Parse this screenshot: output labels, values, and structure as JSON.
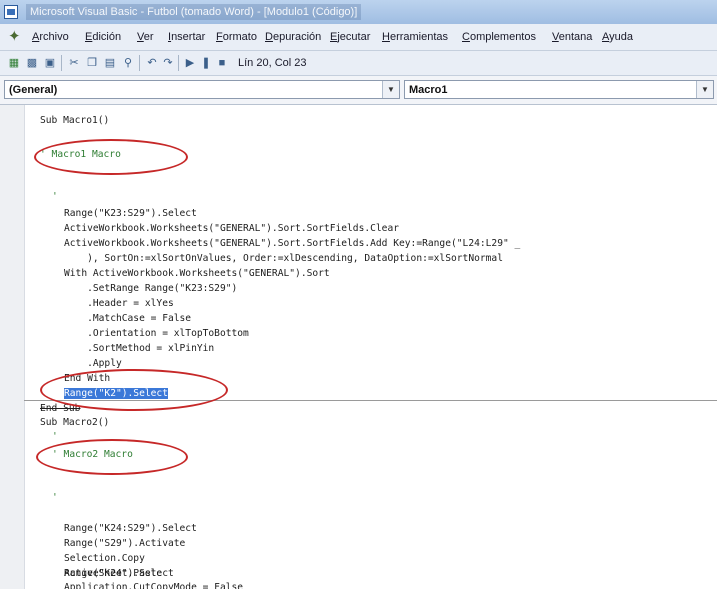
{
  "window": {
    "title": "Microsoft Visual Basic - Futbol (tomado Word) - [Modulo1 (Código)]"
  },
  "menu": {
    "items": [
      "Archivo",
      "Edición",
      "Ver",
      "Insertar",
      "Formato",
      "Depuración",
      "Ejecutar",
      "Herramientas",
      "Complementos",
      "Ventana",
      "Ayuda"
    ]
  },
  "toolbar": {
    "position_text": "Lín 20, Col 23"
  },
  "object_combo": {
    "value": "(General)"
  },
  "procedure_combo": {
    "value": "Macro1"
  },
  "code": {
    "macro1": {
      "sub_line": "Sub Macro1()",
      "comment": "' Macro1 Macro",
      "blank_comment": "'",
      "lines": [
        "Range(\"K23:S29\").Select",
        "ActiveWorkbook.Worksheets(\"GENERAL\").Sort.SortFields.Clear",
        "ActiveWorkbook.Worksheets(\"GENERAL\").Sort.SortFields.Add Key:=Range(\"L24:L29\" _",
        "    ), SortOn:=xlSortOnValues, Order:=xlDescending, DataOption:=xlSortNormal",
        "With ActiveWorkbook.Worksheets(\"GENERAL\").Sort",
        "    .SetRange Range(\"K23:S29\")",
        "    .Header = xlYes",
        "    .MatchCase = False",
        "    .Orientation = xlTopToBottom",
        "    .SortMethod = xlPinYin",
        "    .Apply",
        "End With"
      ],
      "selected_line": "Range(\"K2\").Select",
      "end_sub": "End Sub"
    },
    "macro2": {
      "sub_line": "Sub Macro2()",
      "blank_comment": "'",
      "comment": "' Macro2 Macro",
      "blank_comment2": "'",
      "lines": [
        "Range(\"K24:S29\").Select",
        "Range(\"S29\").Activate",
        "Selection.Copy",
        "Range(\"K24\").Select",
        "ActiveSheet.Paste",
        "Application.CutCopyMode = False"
      ]
    }
  },
  "colors": {
    "comment": "#2e7d32",
    "selection": "#3b78d8",
    "annotation": "#c62828"
  }
}
